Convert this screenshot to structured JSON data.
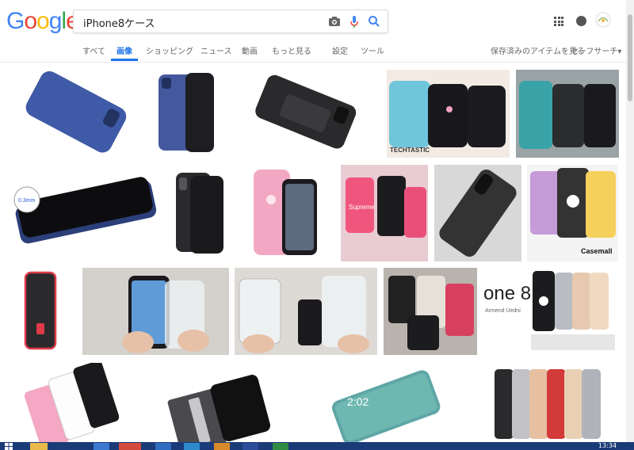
{
  "search": {
    "query": "iPhone8ケース"
  },
  "tabs": [
    {
      "label": "すべて"
    },
    {
      "label": "画像"
    },
    {
      "label": "ショッピング"
    },
    {
      "label": "ニュース"
    },
    {
      "label": "動画"
    },
    {
      "label": "もっと見る"
    },
    {
      "label": "設定"
    },
    {
      "label": "ツール"
    }
  ],
  "right_links": {
    "saved": "保存済みのアイテムを見る",
    "safesearch": "セーフサーチ▾"
  },
  "images": {
    "thumb_texts": {
      "techtastic": "TECHTASTIC",
      "casemall": "Casemall",
      "phone8": "one 8",
      "phone8_sub": "Armend Uedni",
      "lock_time": "2:02",
      "supreme": "Supreme"
    }
  },
  "taskbar": {
    "time": "13:34"
  },
  "colors": {
    "google_blue": "#4285f4",
    "google_red": "#ea4335",
    "google_yellow": "#fbbc05",
    "google_green": "#34a853",
    "active_tab": "#1a73e8"
  }
}
